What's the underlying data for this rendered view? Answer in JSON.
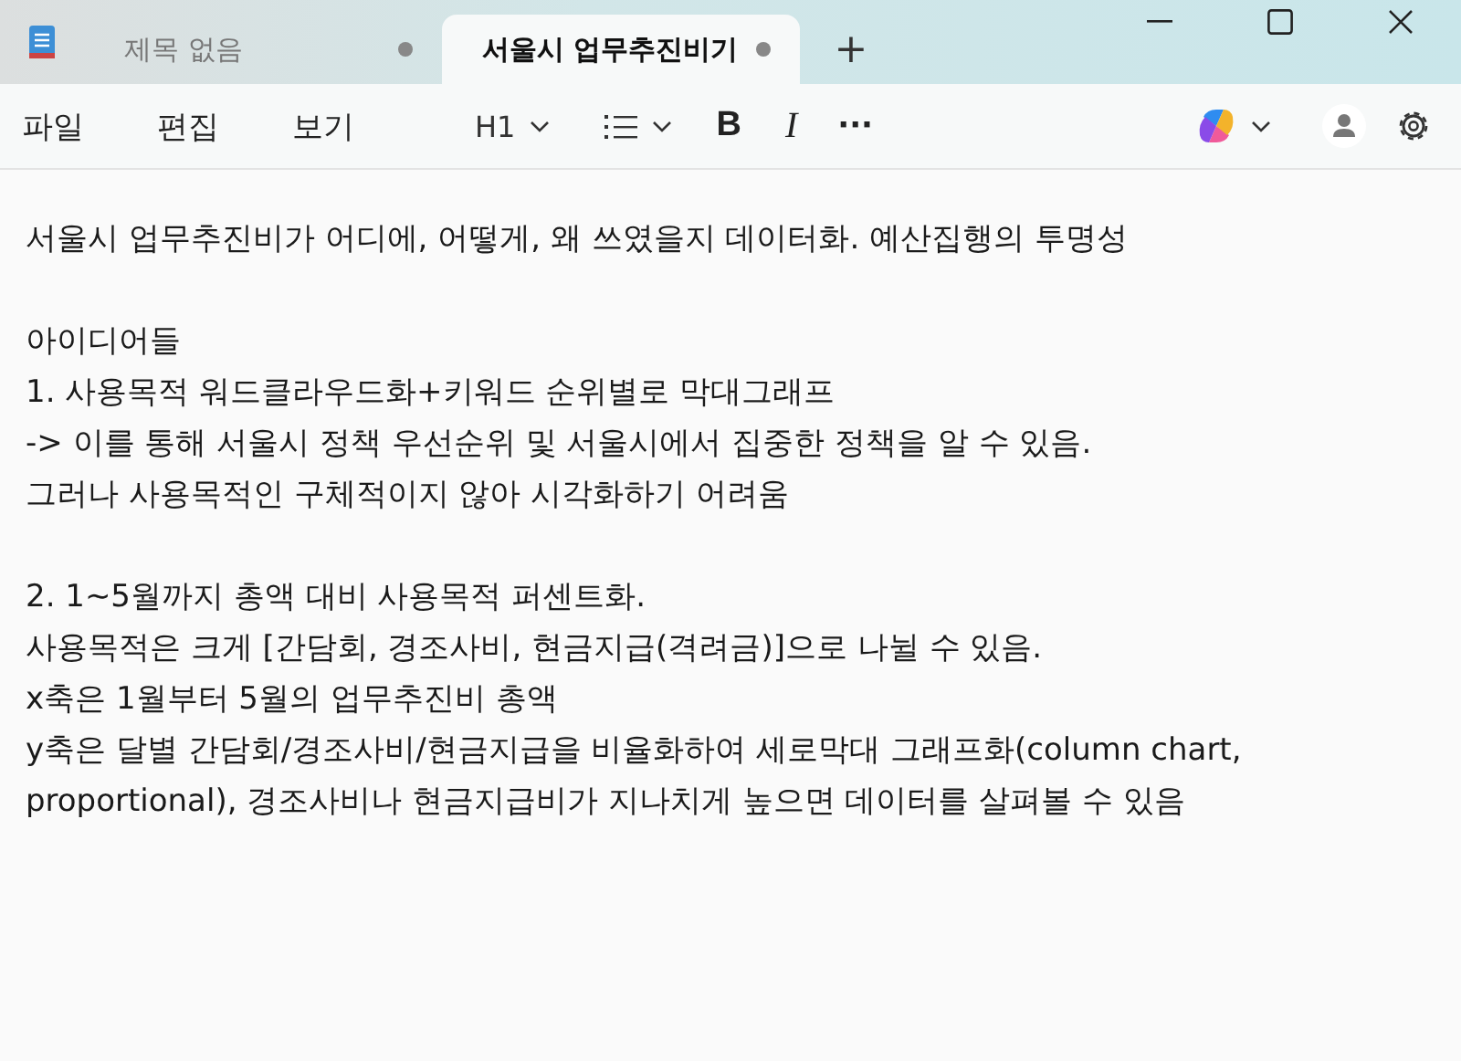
{
  "tabs": [
    {
      "label": "제목 없음",
      "selected": false,
      "modified": true
    },
    {
      "label": "서울시 업무추진비기",
      "selected": true,
      "modified": true
    }
  ],
  "new_tab": "+",
  "menu": [
    "파일",
    "편집",
    "보기"
  ],
  "toolbar": {
    "heading": "H1",
    "bold": "B",
    "italic": "I",
    "more": "···"
  },
  "document": {
    "blocks": [
      [
        "서울시 업무추진비가 어디에, 어떻게, 왜 쓰였을지 데이터화. 예산집행의 투명성"
      ],
      [
        "아이디어들",
        "1. 사용목적 워드클라우드화+키워드 순위별로 막대그래프",
        "-> 이를 통해 서울시 정책 우선순위 및 서울시에서 집중한 정책을 알 수 있음.",
        "그러나 사용목적인 구체적이지 않아 시각화하기 어려움"
      ],
      [
        "2. 1~5월까지 총액 대비 사용목적 퍼센트화.",
        "사용목적은 크게 [간담회, 경조사비, 현금지급(격려금)]으로 나뉠 수 있음.",
        "x축은 1월부터 5월의 업무추진비 총액",
        "y축은 달별 간담회/경조사비/현금지급을 비율화하여 세로막대 그래프화(column chart, proportional), 경조사비나 현금지급비가 지나치게 높으면 데이터를 살펴볼 수 있음"
      ]
    ]
  }
}
